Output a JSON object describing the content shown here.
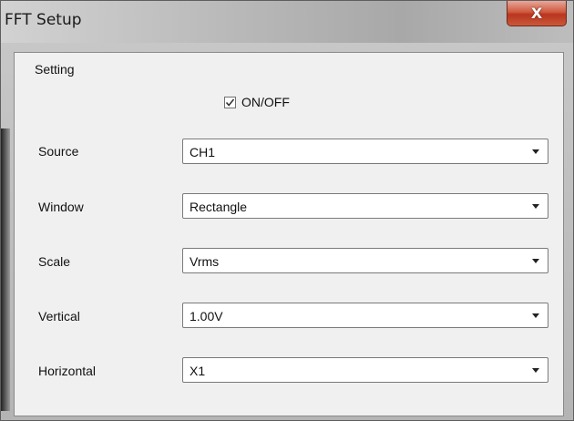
{
  "window": {
    "title": "FFT Setup",
    "close_label": "X"
  },
  "group": {
    "label": "Setting"
  },
  "onoff": {
    "label": "ON/OFF",
    "checked": true
  },
  "fields": [
    {
      "label": "Source",
      "value": "CH1"
    },
    {
      "label": "Window",
      "value": "Rectangle"
    },
    {
      "label": "Scale",
      "value": "Vrms"
    },
    {
      "label": "Vertical",
      "value": "1.00V"
    },
    {
      "label": "Horizontal",
      "value": "X1"
    }
  ]
}
